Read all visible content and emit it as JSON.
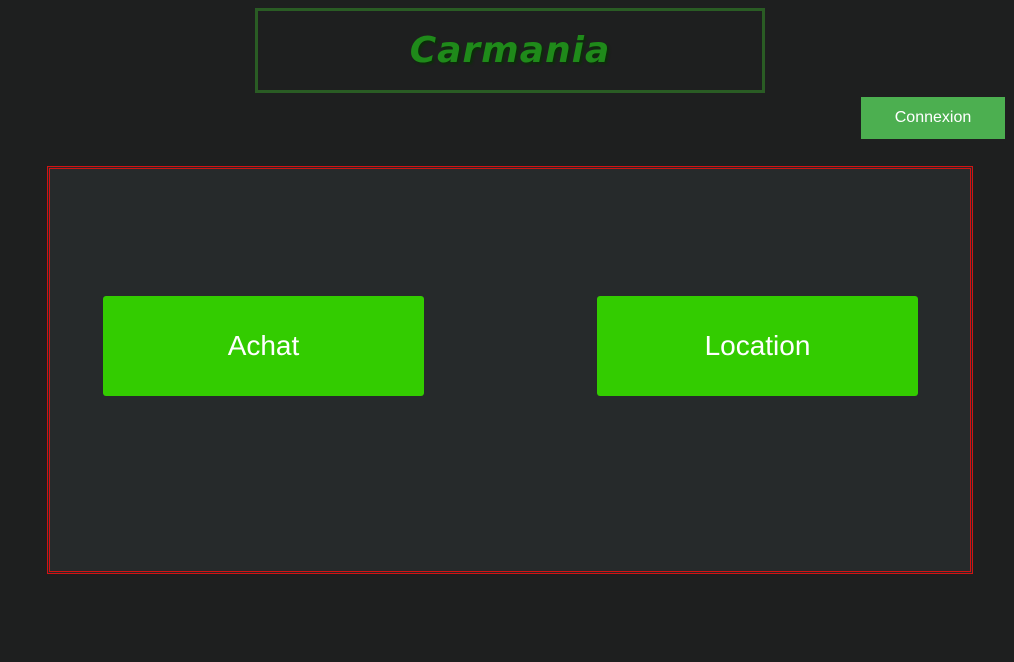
{
  "header": {
    "title": "Carmania"
  },
  "auth": {
    "login_label": "Connexion"
  },
  "main": {
    "choices": [
      {
        "label": "Achat"
      },
      {
        "label": "Location"
      }
    ]
  },
  "colors": {
    "background": "#1e1f1f",
    "panel_background": "#262a2b",
    "panel_border": "#d11313",
    "title_border": "#2a5c24",
    "title_text": "#1f8a1a",
    "login_button": "#4caf50",
    "choice_button": "#33cc00"
  }
}
